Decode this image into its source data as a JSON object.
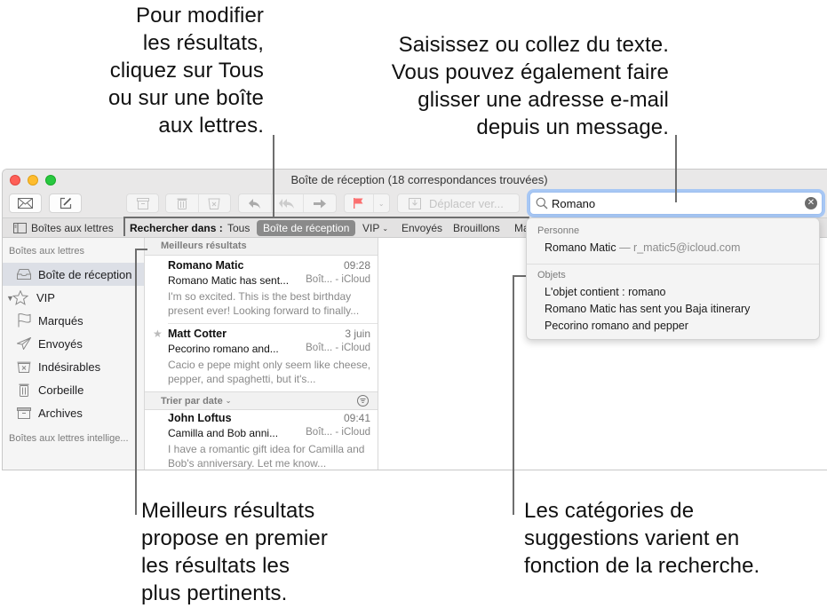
{
  "callouts": {
    "top_left": [
      "Pour modifier",
      "les résultats,",
      "cliquez sur Tous",
      "ou sur une boîte",
      "aux lettres."
    ],
    "top_right": [
      "Saisissez ou collez du texte.",
      "Vous pouvez également faire",
      "glisser une adresse e-mail",
      "depuis un message."
    ],
    "bottom_left": [
      "Meilleurs résultats",
      "propose en premier",
      "les résultats les",
      "plus pertinents."
    ],
    "bottom_right": [
      "Les catégories de",
      "suggestions varient en",
      "fonction de la recherche."
    ]
  },
  "window": {
    "title": "Boîte de réception (18 correspondances trouvées)"
  },
  "toolbar": {
    "get_mail_icon": "envelope-icon",
    "compose_icon": "compose-icon",
    "archive_icon": "archive-icon",
    "delete_icon": "trash-icon",
    "junk_icon": "junk-icon",
    "reply_icon": "reply-icon",
    "reply_all_icon": "reply-all-icon",
    "forward_icon": "forward-icon",
    "flag_icon": "flag-icon",
    "move_label": "Déplacer ver...",
    "flag_color": "#fb6f6f"
  },
  "search": {
    "value": "Romano",
    "accent": "#9dbff0"
  },
  "scopebar": {
    "mailboxes_label": "Boîtes aux lettres",
    "search_in_label": "Rechercher dans :",
    "scopes": [
      {
        "label": "Tous",
        "selected": false
      },
      {
        "label": "Boîte de réception",
        "selected": true
      },
      {
        "label": "VIP",
        "selected": false
      },
      {
        "label": "Envoyés",
        "selected": false
      },
      {
        "label": "Brouillons",
        "selected": false
      },
      {
        "label": "Ma",
        "selected": false
      }
    ]
  },
  "sidebar": {
    "section_mailboxes": "Boîtes aux lettres",
    "items": [
      {
        "label": "Boîte de réception",
        "icon": "inbox-icon",
        "selected": true
      },
      {
        "label": "VIP",
        "icon": "star-icon",
        "selected": false
      },
      {
        "label": "Marqués",
        "icon": "flag-icon",
        "selected": false
      },
      {
        "label": "Envoyés",
        "icon": "sent-icon",
        "selected": false
      },
      {
        "label": "Indésirables",
        "icon": "junk-icon",
        "selected": false
      },
      {
        "label": "Corbeille",
        "icon": "trash-icon",
        "selected": false
      },
      {
        "label": "Archives",
        "icon": "archive-icon",
        "selected": false
      }
    ],
    "section_smart": "Boîtes aux lettres intellige..."
  },
  "message_list": {
    "top_hits_header": "Meilleurs résultats",
    "sort_header": "Trier par date",
    "top_hits": [
      {
        "from": "Romano Matic",
        "time": "09:28",
        "subject": "Romano Matic has sent...",
        "mailbox": "Boît... - iCloud",
        "preview": "I'm so excited. This is the best birthday present ever! Looking forward to finally...",
        "starred": false
      },
      {
        "from": "Matt Cotter",
        "time": "3 juin",
        "subject": "Pecorino romano and...",
        "mailbox": "Boît... - iCloud",
        "preview": "Cacio e pepe might only seem like cheese, pepper, and spaghetti, but it's...",
        "starred": true
      }
    ],
    "sorted": [
      {
        "from": "John Loftus",
        "time": "09:41",
        "subject": "Camilla and Bob anni...",
        "mailbox": "Boît... - iCloud",
        "preview": "I have a romantic gift idea for Camilla and Bob's anniversary. Let me know...",
        "starred": false
      }
    ]
  },
  "suggestions": {
    "people_header": "Personne",
    "people": [
      {
        "name": "Romano Matic",
        "separator": " — ",
        "email": "r_matic5@icloud.com"
      }
    ],
    "subjects_header": "Objets",
    "subjects": [
      "L'objet contient : romano",
      "Romano Matic has sent you Baja itinerary",
      "Pecorino romano and pepper"
    ]
  }
}
